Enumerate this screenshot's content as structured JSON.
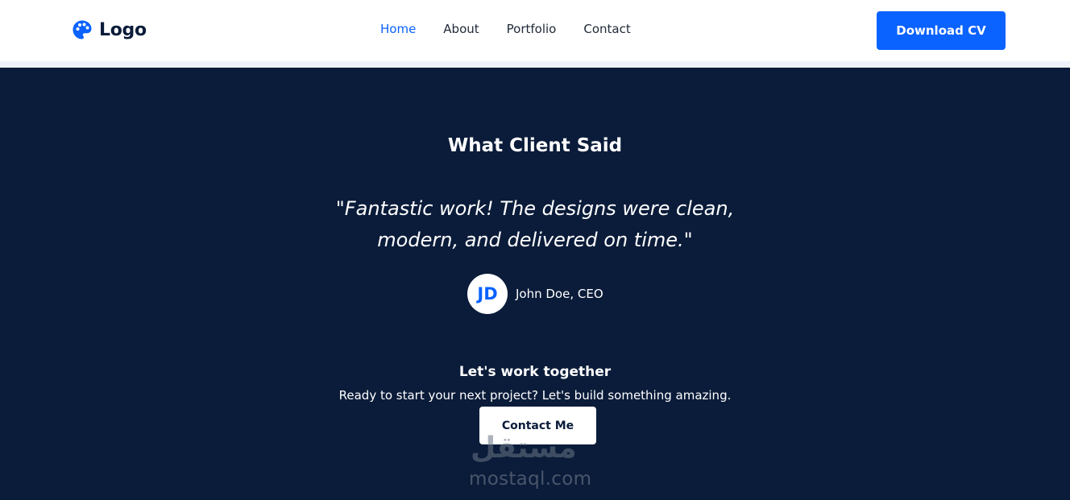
{
  "nav": {
    "logo_text": "Logo",
    "links": [
      {
        "label": "Home",
        "active": true
      },
      {
        "label": "About",
        "active": false
      },
      {
        "label": "Portfolio",
        "active": false
      },
      {
        "label": "Contact",
        "active": false
      }
    ],
    "cta_label": "Download CV"
  },
  "testimonial": {
    "title": "What Client Said",
    "quote": "\"Fantastic work! The designs were clean, modern, and delivered on time.\"",
    "avatar_initials": "JD",
    "author": "John Doe, CEO"
  },
  "cta": {
    "title": "Let's work together",
    "subtitle": "Ready to start your next project? Let's build something amazing.",
    "button_label": "Contact Me"
  },
  "watermark": {
    "arabic": "مستقل",
    "latin": "mostaql.com"
  },
  "colors": {
    "accent": "#0a62ff",
    "dark_bg": "#0b1c3a",
    "nav_bg": "#ffffff"
  }
}
